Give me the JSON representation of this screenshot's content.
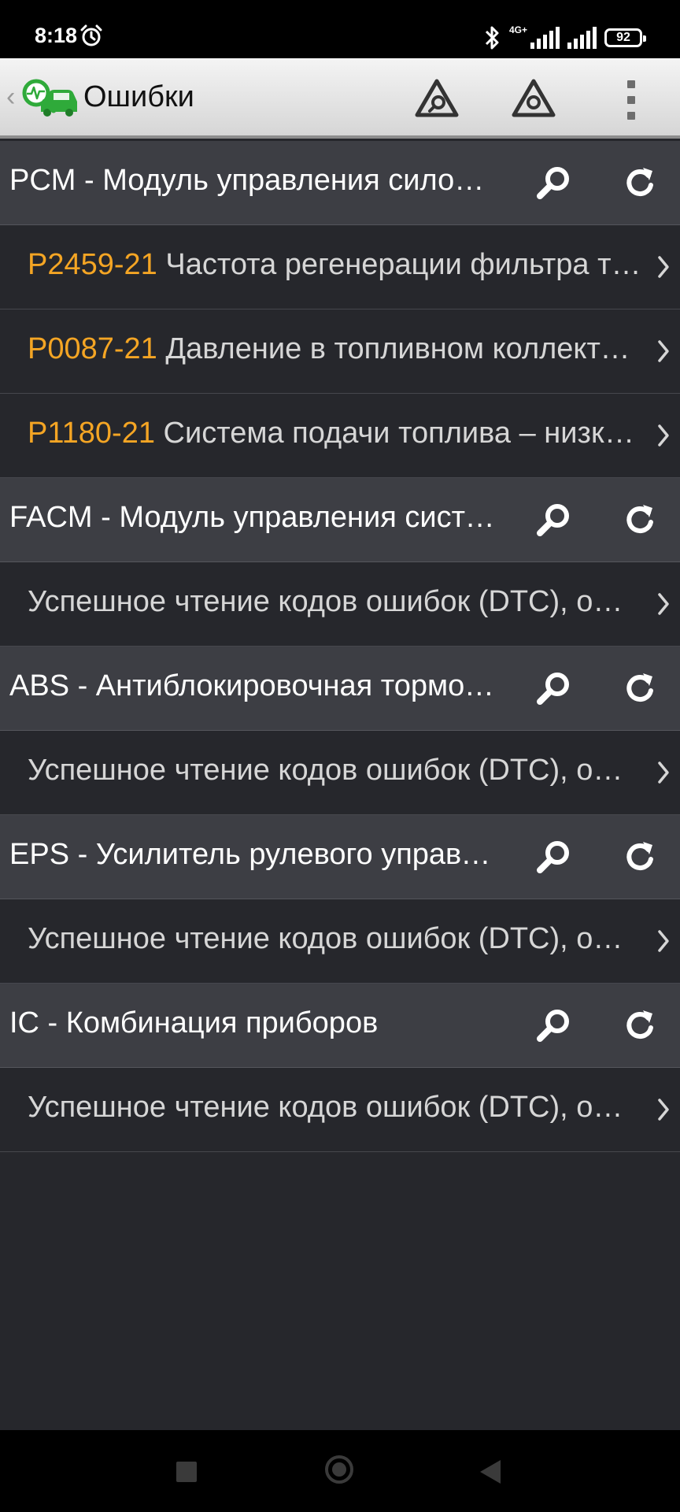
{
  "status_bar": {
    "time": "8:18",
    "network_label": "4G+",
    "battery_level": "92",
    "icons": [
      "alarm-icon",
      "bluetooth-icon",
      "signal-icon",
      "battery-icon"
    ]
  },
  "app_bar": {
    "title": "Ошибки",
    "icons": [
      "back-chevron-icon",
      "app-logo-icon",
      "scan-warning-icon",
      "clear-warning-icon",
      "overflow-menu-icon"
    ]
  },
  "modules": [
    {
      "name": "PCM - Модуль управления силовым агрегатом",
      "entries": [
        {
          "code": "P2459-21",
          "text": "Частота регенерации фильтра твердых частиц"
        },
        {
          "code": "P0087-21",
          "text": "Давление в топливном коллекторе/системе – слишком низкое"
        },
        {
          "code": "P1180-21",
          "text": "Система подачи топлива – низкое давление"
        }
      ]
    },
    {
      "name": "FACM - Модуль управления системой",
      "entries": [
        {
          "code": "",
          "text": "Успешное чтение кодов ошибок (DTC), ошибок нет"
        }
      ]
    },
    {
      "name": "ABS - Антиблокировочная тормозная система",
      "entries": [
        {
          "code": "",
          "text": "Успешное чтение кодов ошибок (DTC), ошибок нет"
        }
      ]
    },
    {
      "name": "EPS - Усилитель рулевого управления",
      "entries": [
        {
          "code": "",
          "text": "Успешное чтение кодов ошибок (DTC), ошибок нет"
        }
      ]
    },
    {
      "name": "IC - Комбинация приборов",
      "entries": [
        {
          "code": "",
          "text": "Успешное чтение кодов ошибок (DTC), ошибок нет"
        }
      ]
    }
  ],
  "colors": {
    "background": "#26272c",
    "module_row": "#3d3e44",
    "dtc_code": "#f4a524",
    "app_bar": "#e4e4e4"
  }
}
